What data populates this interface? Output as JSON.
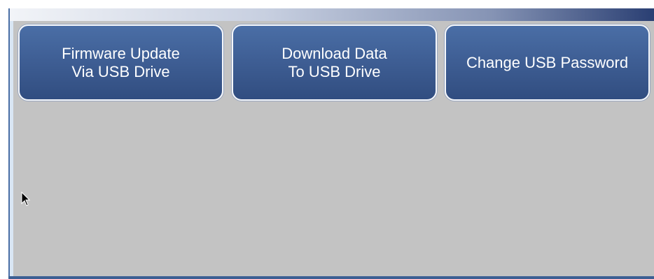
{
  "menu": {
    "buttons": [
      {
        "line1": "Firmware Update",
        "line2": "Via USB Drive"
      },
      {
        "line1": "Download Data",
        "line2": "To USB Drive"
      },
      {
        "line1": "Change USB Password"
      }
    ]
  },
  "icons": {
    "cursor": "arrow-cursor-icon"
  },
  "colors": {
    "button_face": "#3f5f95",
    "panel_background": "#c3c3c3",
    "accent": "#3c5f93",
    "button_text": "#ffffff"
  }
}
